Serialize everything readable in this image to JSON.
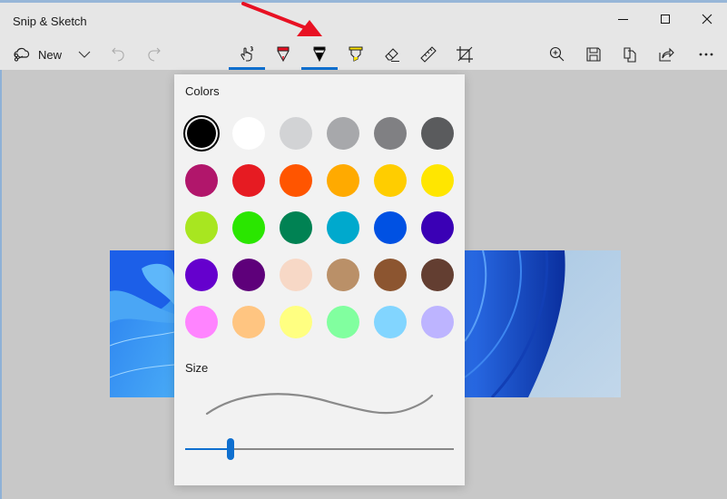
{
  "app": {
    "title": "Snip & Sketch"
  },
  "window_controls": [
    {
      "name": "minimize-button",
      "icon": "minimize-icon"
    },
    {
      "name": "maximize-button",
      "icon": "maximize-icon"
    },
    {
      "name": "close-button",
      "icon": "close-icon"
    }
  ],
  "toolbar": {
    "new_label": "New",
    "left_tools": [
      "snip-icon",
      "chevron-down-icon",
      "undo-icon",
      "redo-icon"
    ],
    "center_tools": [
      {
        "name": "touch-writing",
        "icon": "touch-writing-icon",
        "active": true
      },
      {
        "name": "ballpoint-pen",
        "icon": "ballpoint-pen-icon",
        "color": "#e81123",
        "active": false
      },
      {
        "name": "pencil",
        "icon": "pencil-icon",
        "color": "#000000",
        "active": true
      },
      {
        "name": "highlighter",
        "icon": "highlighter-icon",
        "color": "#ffe500",
        "active": false
      },
      {
        "name": "eraser",
        "icon": "eraser-icon",
        "active": false
      },
      {
        "name": "ruler",
        "icon": "ruler-icon",
        "active": false
      },
      {
        "name": "crop",
        "icon": "crop-icon",
        "active": false
      }
    ],
    "right_tools": [
      "zoom-in-icon",
      "save-icon",
      "copy-icon",
      "share-icon",
      "more-icon"
    ]
  },
  "annotation": {
    "arrow_color": "#e81123"
  },
  "flyout": {
    "colors_label": "Colors",
    "size_label": "Size",
    "selected_color": "#000000",
    "colors": [
      "#000000",
      "#ffffff",
      "#d2d3d5",
      "#a7a8ab",
      "#808083",
      "#5a5b5d",
      "#b1166b",
      "#e61b22",
      "#ff5500",
      "#ffaa00",
      "#ffcd00",
      "#ffe600",
      "#a8e620",
      "#2ae600",
      "#008253",
      "#00a9cd",
      "#0051e3",
      "#3a00b5",
      "#6500cd",
      "#5e007a",
      "#f7d8c6",
      "#ba9068",
      "#8c5530",
      "#633e31",
      "#ff84ff",
      "#ffc581",
      "#ffff81",
      "#81ff9f",
      "#82d5ff",
      "#bdb4ff"
    ],
    "size_percent": 17
  },
  "accent_color": "#0f6fcf"
}
